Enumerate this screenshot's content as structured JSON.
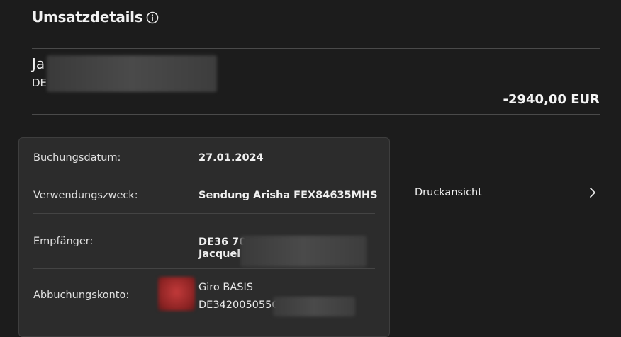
{
  "header": {
    "title": "Umsatzdetails",
    "info_icon": "info-circle-icon"
  },
  "payee": {
    "name_visible": "Ja",
    "iban_visible": "DE"
  },
  "amount": "-2940,00 EUR",
  "details": {
    "booking_date_label": "Buchungsdatum:",
    "booking_date_value": "27.01.2024",
    "purpose_label": "Verwendungszweck:",
    "purpose_value": "Sendung Arisha FEX84635MHS",
    "recipient_label": "Empfänger:",
    "recipient_iban_visible": "DE36 70",
    "recipient_name_visible": "Jacquel",
    "debit_account_label": "Abbuchungskonto:",
    "debit_account_name": "Giro BASIS",
    "debit_account_iban_visible": "DE342005055C"
  },
  "actions": {
    "print_view_label": "Druckansicht",
    "chevron_icon": "chevron-right-icon"
  }
}
